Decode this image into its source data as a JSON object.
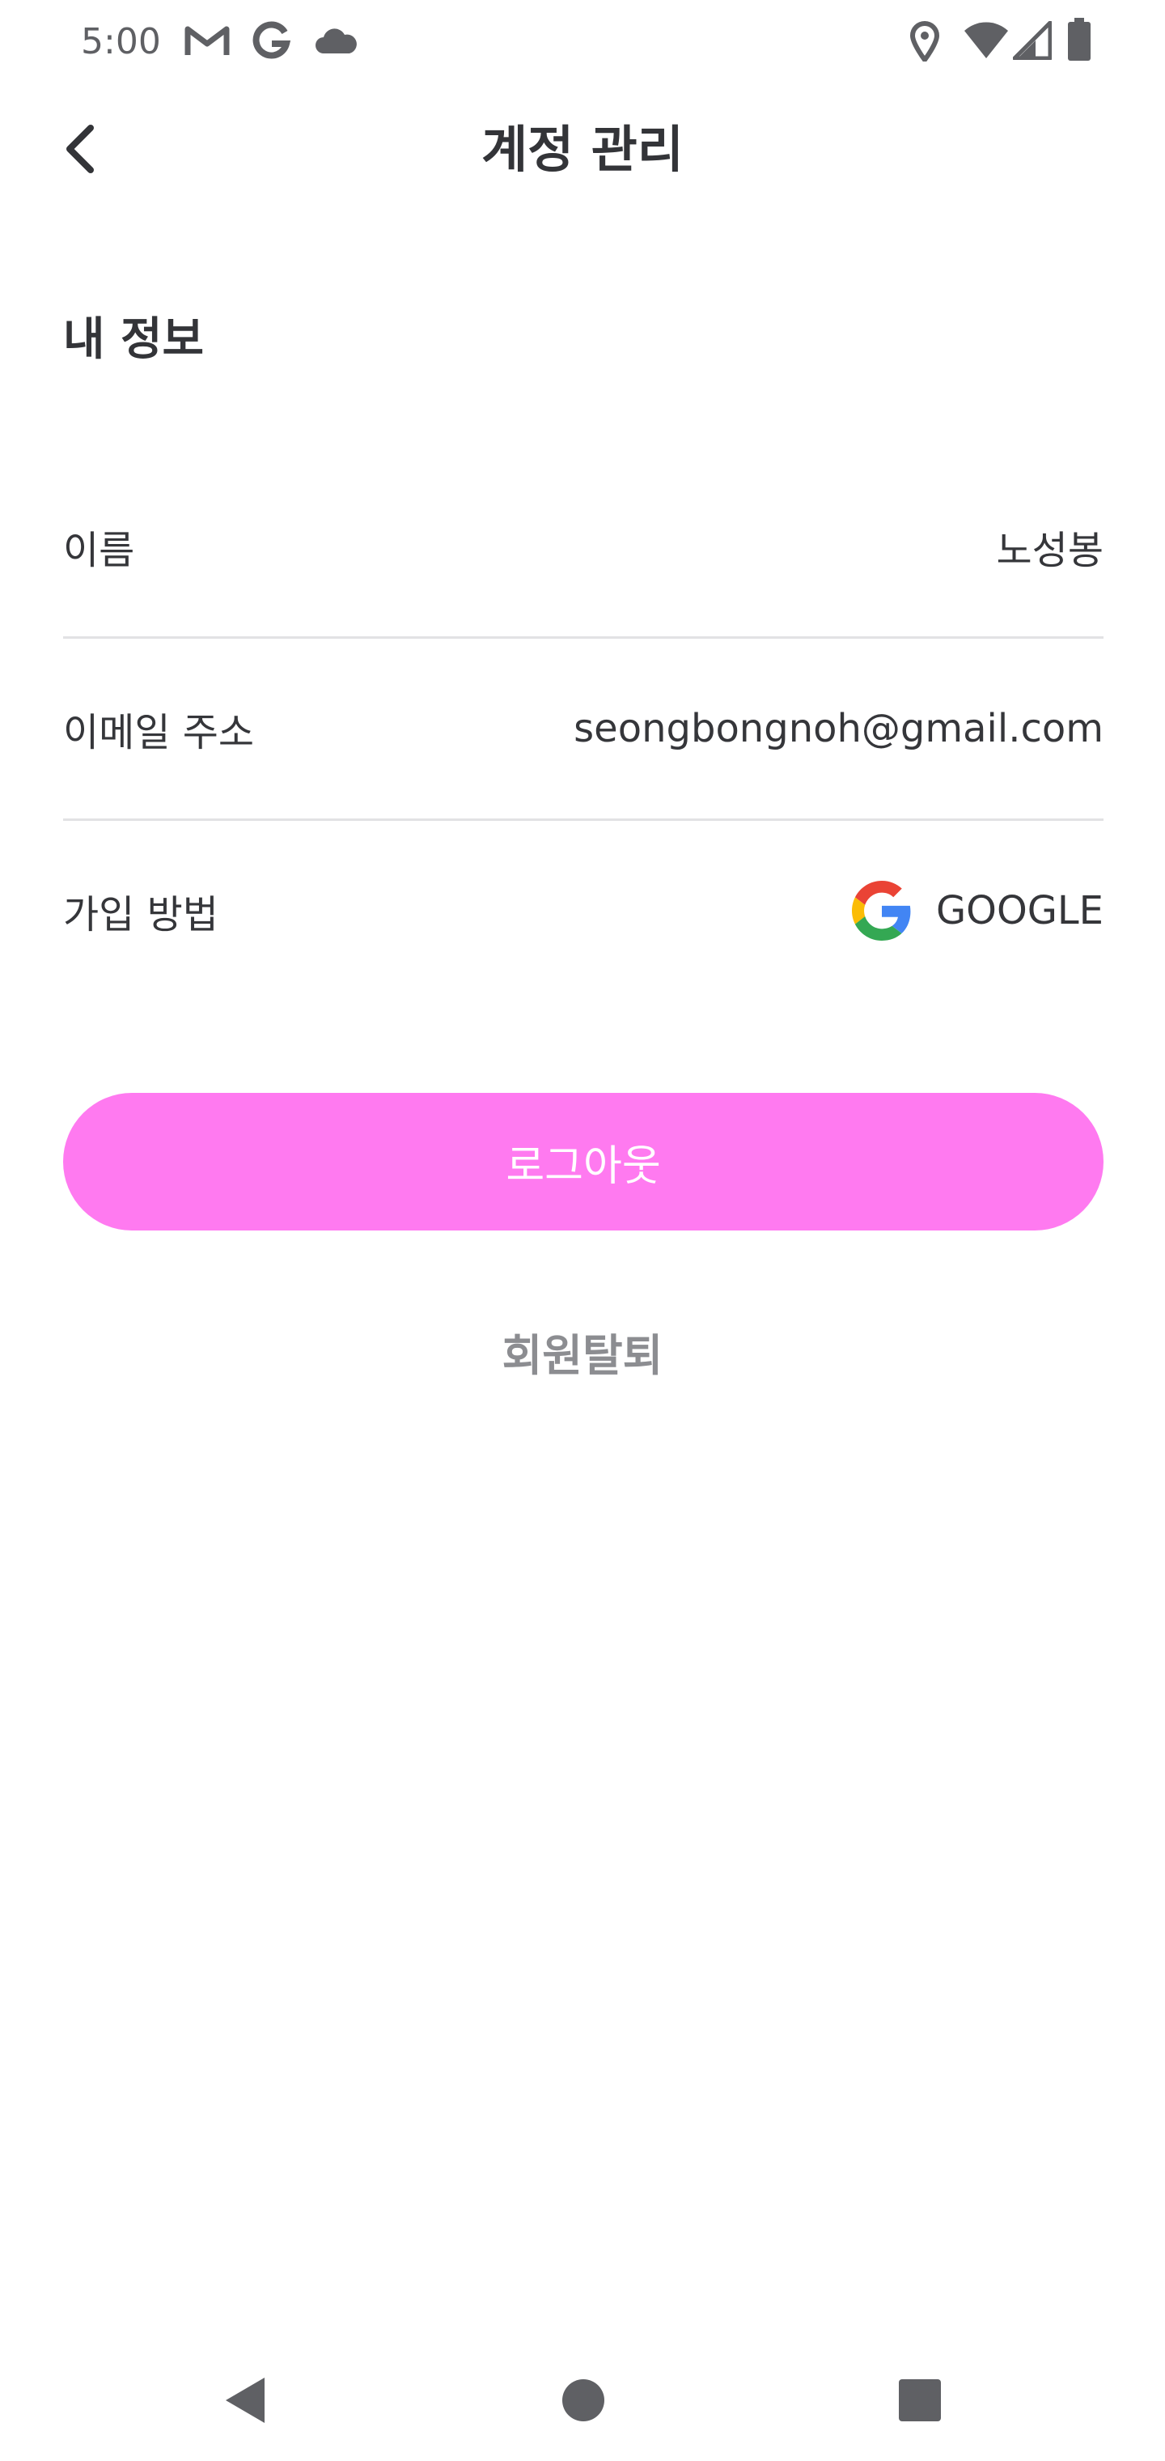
{
  "status_bar": {
    "time": "5:00",
    "left_icons": [
      "gmail-icon",
      "google-icon",
      "cloud-icon"
    ],
    "right_icons": [
      "location-icon",
      "wifi-icon",
      "signal-icon",
      "battery-icon"
    ]
  },
  "header": {
    "title": "계정 관리",
    "back_icon": "chevron-left-icon"
  },
  "section": {
    "title": "내 정보"
  },
  "rows": [
    {
      "label": "이름",
      "value": "노성봉"
    },
    {
      "label": "이메일 주소",
      "value": "seongbongnoh@gmail.com"
    },
    {
      "label": "가입 방법",
      "value": "GOOGLE",
      "icon": "google-logo-icon"
    }
  ],
  "actions": {
    "logout_label": "로그아웃",
    "withdraw_label": "회원탈퇴"
  },
  "nav_bar": {
    "icons": [
      "back-triangle-icon",
      "home-circle-icon",
      "recents-square-icon"
    ]
  },
  "colors": {
    "accent": "#ff7af0",
    "text": "#35363a",
    "muted": "#8c8d91",
    "divider": "#e2e2e4"
  }
}
